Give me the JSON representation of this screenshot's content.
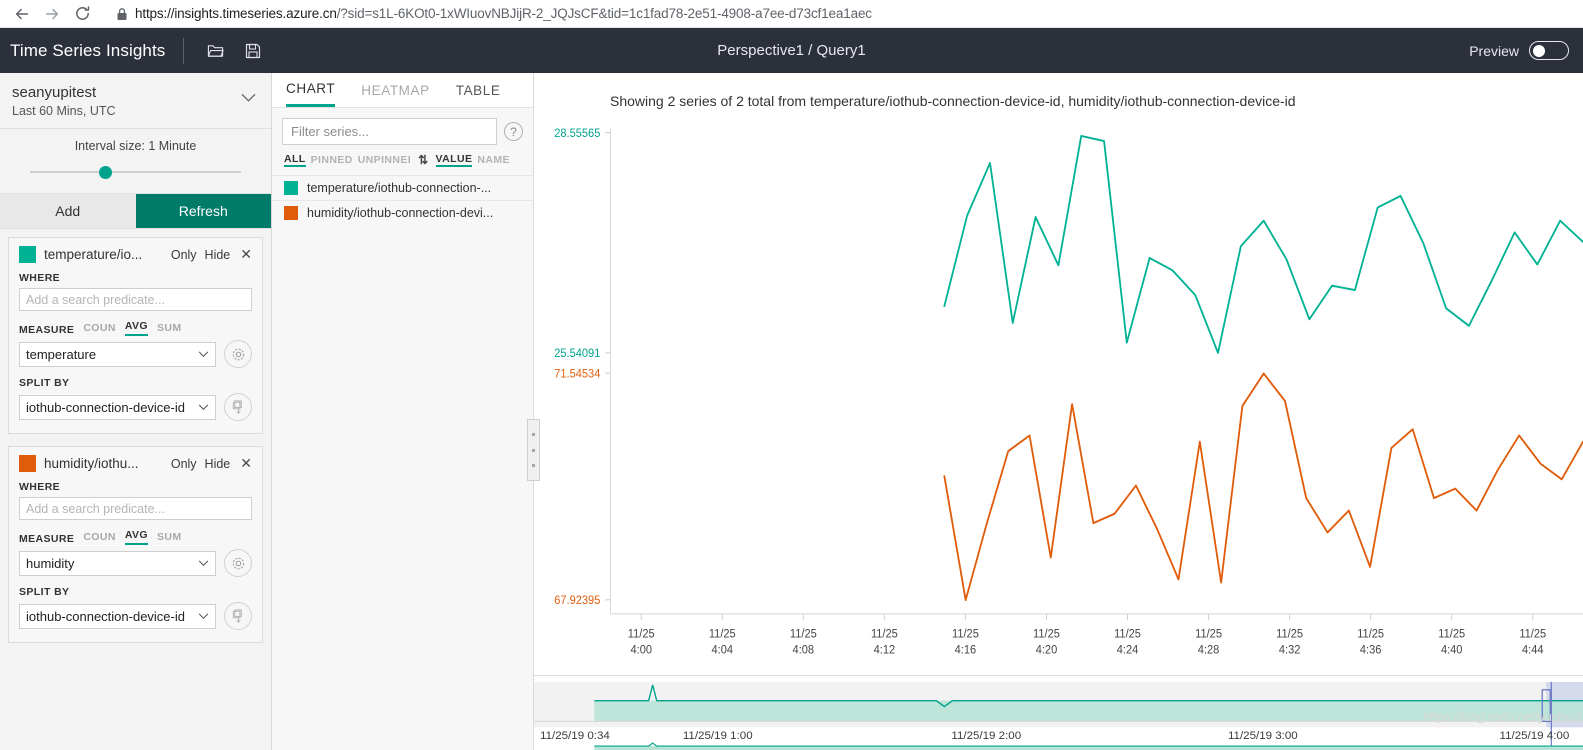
{
  "browser": {
    "back_icon": "back-arrow-icon",
    "forward_icon": "forward-arrow-icon",
    "reload_icon": "reload-icon",
    "lock_icon": "lock-icon",
    "url_host": "https://insights.timeseries.azure.cn",
    "url_path": "/?sid=s1L-6KOt0-1xWIuovNBJijR-2_JQJsCF&tid=1c1fad78-2e51-4908-a7ee-d73cf1ea1aec"
  },
  "header": {
    "app_title": "Time Series Insights",
    "open_icon": "open-folder-icon",
    "save_icon": "save-disk-icon",
    "breadcrumb": "Perspective1 / Query1",
    "preview_label": "Preview",
    "preview_on": false
  },
  "sidebar": {
    "environment_name": "seanyupitest",
    "time_range": "Last 60 Mins, UTC",
    "chevron_icon": "chevron-down-icon",
    "interval_label": "Interval size: 1 Minute",
    "add_label": "Add",
    "refresh_label": "Refresh",
    "field_labels": {
      "where": "WHERE",
      "measure": "MEASURE",
      "split_by": "SPLIT BY"
    },
    "aggregations": [
      "COUN",
      "AVG",
      "SUM"
    ],
    "active_aggregation": "AVG",
    "where_placeholder": "Add a search predicate...",
    "queries": [
      {
        "color": "#00b294",
        "title": "temperature/io...",
        "only_label": "Only",
        "hide_label": "Hide",
        "close_icon": "close-icon",
        "where_value": "",
        "measure": "temperature",
        "split_by": "iothub-connection-device-id",
        "settings_icon": "gear-icon",
        "clone_icon": "clone-down-icon"
      },
      {
        "color": "#e05c0a",
        "title": "humidity/iothu...",
        "only_label": "Only",
        "hide_label": "Hide",
        "close_icon": "close-icon",
        "where_value": "",
        "measure": "humidity",
        "split_by": "iothub-connection-device-id",
        "settings_icon": "gear-icon",
        "clone_icon": "clone-down-icon"
      }
    ]
  },
  "series_panel": {
    "tabs": [
      {
        "label": "CHART",
        "active": true
      },
      {
        "label": "HEATMAP",
        "active": false
      },
      {
        "label": "TABLE",
        "active": false
      }
    ],
    "filter_placeholder": "Filter series...",
    "help_icon": "help-circle-icon",
    "pin_filters": [
      {
        "label": "ALL",
        "active": true
      },
      {
        "label": "PINNED",
        "active": false
      },
      {
        "label": "UNPINNEI",
        "active": false
      }
    ],
    "sort_icon": "sort-updown-icon",
    "sort_options": [
      {
        "label": "VALUE",
        "active": true
      },
      {
        "label": "NAME",
        "active": false
      }
    ],
    "series": [
      {
        "color": "#00b294",
        "label": "temperature/iothub-connection-..."
      },
      {
        "color": "#e05c0a",
        "label": "humidity/iothub-connection-devi..."
      }
    ],
    "drag_handle_icon": "drag-handle-icon"
  },
  "chart_data": {
    "type": "line",
    "title": "Showing 2 series of 2 total from temperature/iothub-connection-device-id, humidity/iothub-connection-device-id",
    "xlabel": "",
    "ylabel": "",
    "grid": false,
    "legend": "left-panel",
    "x_tick_labels": [
      "11/25\n4:00",
      "11/25\n4:04",
      "11/25\n4:08",
      "11/25\n4:12",
      "11/25\n4:16",
      "11/25\n4:20",
      "11/25\n4:24",
      "11/25\n4:28",
      "11/25\n4:32",
      "11/25\n4:36",
      "11/25\n4:40",
      "11/25\n4:44"
    ],
    "x_tick_dates": [
      "11/25",
      "11/25",
      "11/25",
      "11/25",
      "11/25",
      "11/25",
      "11/25",
      "11/25",
      "11/25",
      "11/25",
      "11/25",
      "11/25"
    ],
    "x_tick_times": [
      "4:00",
      "4:04",
      "4:08",
      "4:12",
      "4:16",
      "4:20",
      "4:24",
      "4:28",
      "4:32",
      "4:36",
      "4:40",
      "4:44"
    ],
    "y_axes": [
      {
        "series": "temperature/iothub-connection-device-id",
        "color": "#00b294",
        "max_label": "28.55565",
        "min_label": "25.54091",
        "max": 28.55565,
        "min": 25.54091
      },
      {
        "series": "humidity/iothub-connection-device-id",
        "color": "#e05c0a",
        "max_label": "71.54534",
        "min_label": "67.92395",
        "max": 71.54534,
        "min": 67.92395
      }
    ],
    "series": [
      {
        "name": "temperature/iothub-connection-device-id",
        "color": "#00b294",
        "axis": "left-teal",
        "values": [
          26.18,
          27.42,
          28.14,
          25.95,
          27.4,
          26.74,
          28.51,
          28.44,
          25.68,
          26.84,
          26.67,
          26.33,
          25.54,
          27.0,
          27.35,
          26.82,
          26.0,
          26.46,
          26.4,
          27.53,
          27.69,
          27.04,
          26.15,
          25.91,
          26.53,
          27.19,
          26.75,
          27.35,
          27.06
        ]
      },
      {
        "name": "humidity/iothub-connection-device-id",
        "color": "#e05c0a",
        "axis": "left-orange",
        "values": [
          69.9,
          67.92,
          69.15,
          70.3,
          70.55,
          68.6,
          71.05,
          69.15,
          69.3,
          69.75,
          69.05,
          68.25,
          70.45,
          68.2,
          71.02,
          71.54,
          71.1,
          69.55,
          69.0,
          69.35,
          68.45,
          70.35,
          70.65,
          69.55,
          69.7,
          69.35,
          70.0,
          70.55,
          70.1,
          69.85,
          70.45
        ]
      }
    ]
  },
  "timeline": {
    "tick_labels": [
      "11/25/19 0:34",
      "11/25/19 1:00",
      "11/25/19 2:00",
      "11/25/19 3:00",
      "11/25/19 4:00"
    ],
    "selection_start_pct": 96.5,
    "selection_end_pct": 100,
    "brush_color": "#b6e3d6",
    "watermark": "https://blog.csdn.net/yushuzi"
  }
}
